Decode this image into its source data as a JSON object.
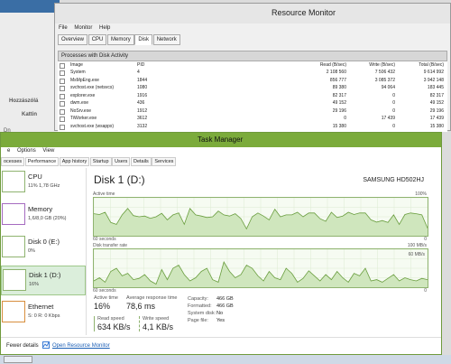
{
  "bg": {
    "text1": "Hozzászólá",
    "text2": "Kattin",
    "text3": "Dn"
  },
  "rm": {
    "title": "Resource Monitor",
    "menu": [
      "File",
      "Monitor",
      "Help"
    ],
    "tabs": [
      "Overview",
      "CPU",
      "Memory",
      "Disk",
      "Network"
    ],
    "active_tab": "Disk",
    "section": "Processes with Disk Activity",
    "columns": [
      "Image",
      "PID",
      "Read (B/sec)",
      "Write (B/sec)",
      "Total (B/sec)"
    ],
    "rows": [
      [
        "System",
        "4",
        "2 108 560",
        "7 506 432",
        "9 614 992"
      ],
      [
        "MsMpEng.exe",
        "1844",
        "856 777",
        "3 085 372",
        "3 942 148"
      ],
      [
        "svchost.exe (netsvcs)",
        "1080",
        "89 380",
        "94 064",
        "183 445"
      ],
      [
        "explorer.exe",
        "1916",
        "82 317",
        "0",
        "82 317"
      ],
      [
        "dwm.exe",
        "436",
        "49 152",
        "0",
        "49 152"
      ],
      [
        "NoSrv.exe",
        "1912",
        "29 196",
        "0",
        "29 196"
      ],
      [
        "TiWorker.exe",
        "3612",
        "0",
        "17 439",
        "17 439"
      ],
      [
        "svchost.exe (wsappx)",
        "3132",
        "15 380",
        "0",
        "15 380"
      ]
    ]
  },
  "tm": {
    "title": "Task Manager",
    "menu": [
      "e",
      "Options",
      "View"
    ],
    "tabs": [
      "ocesses",
      "Performance",
      "App history",
      "Startup",
      "Users",
      "Details",
      "Services"
    ],
    "sidebar": [
      {
        "name": "CPU",
        "sub": "11%  1,78 GHz",
        "color": "#8fb36f"
      },
      {
        "name": "Memory",
        "sub": "1,6/8,0 GB (20%)",
        "color": "#a56bc0"
      },
      {
        "name": "Disk 0 (E:)",
        "sub": "0%",
        "color": "#8fb36f"
      },
      {
        "name": "Disk 1 (D:)",
        "sub": "16%",
        "color": "#8fb36f"
      },
      {
        "name": "Ethernet",
        "sub": "S: 0  R: 0 Kbps",
        "color": "#d88e3d"
      }
    ],
    "disk_title": "Disk 1 (D:)",
    "model": "SAMSUNG HD502HJ",
    "g1_label": "Active time",
    "g1_max": "100%",
    "g1_time": "60 seconds",
    "g1_min": "0",
    "g2_label": "Disk transfer rate",
    "g2_max": "100 MB/s",
    "g2_inner": "60 MB/s",
    "g2_time": "60 seconds",
    "g2_min": "0",
    "active_time_label": "Active time",
    "active_time": "16%",
    "resp_label": "Average response time",
    "resp": "78,6 ms",
    "read_label": "Read speed",
    "read": "634 KB/s",
    "write_label": "Write speed",
    "write": "4,1 KB/s",
    "kv": [
      [
        "Capacity:",
        "466 GB"
      ],
      [
        "Formatted:",
        "466 GB"
      ],
      [
        "System disk:",
        "No"
      ],
      [
        "Page file:",
        "Yes"
      ]
    ],
    "fewer": "Fewer details",
    "open_rm": "Open Resource Monitor"
  },
  "chart_data": {
    "type": "area",
    "active_time_percent": [
      58,
      56,
      62,
      35,
      30,
      55,
      72,
      53,
      50,
      52,
      46,
      50,
      59,
      42,
      55,
      60,
      30,
      72,
      55,
      52,
      48,
      50,
      65,
      55,
      52,
      58,
      45,
      18,
      50,
      60,
      52,
      42,
      70,
      50,
      55,
      55,
      62,
      50,
      60,
      60,
      45,
      38,
      62,
      48,
      52,
      62,
      56,
      60,
      60,
      42,
      36,
      40,
      35,
      55,
      30,
      56,
      60,
      58,
      55,
      20
    ],
    "transfer_rate_mb_s": [
      10,
      15,
      8,
      25,
      30,
      18,
      22,
      12,
      14,
      20,
      10,
      5,
      28,
      12,
      30,
      35,
      20,
      10,
      15,
      25,
      30,
      12,
      8,
      40,
      25,
      15,
      20,
      35,
      30,
      18,
      10,
      25,
      15,
      12,
      30,
      22,
      8,
      14,
      26,
      18,
      10,
      20,
      12,
      25,
      15,
      8,
      22,
      18,
      30,
      10,
      12,
      8,
      14,
      20,
      10,
      15,
      12,
      10,
      14,
      12
    ]
  }
}
